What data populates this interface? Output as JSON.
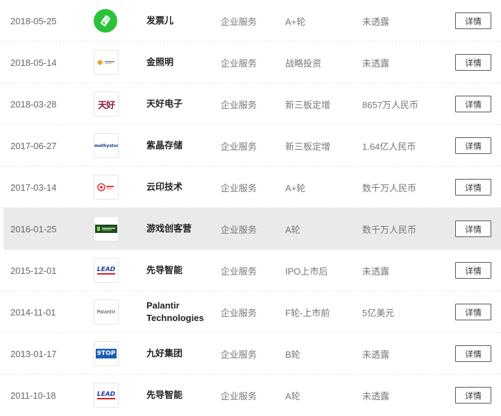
{
  "rows": [
    {
      "date": "2018-05-25",
      "name": "发票儿",
      "industry": "企业服务",
      "round": "A+轮",
      "amount": "未透露",
      "logo": "fapiaoer-logo",
      "action": "详情"
    },
    {
      "date": "2018-05-14",
      "name": "金照明",
      "industry": "企业服务",
      "round": "战略投资",
      "amount": "未透露",
      "logo": "jinzhaoming-logo",
      "action": "详情"
    },
    {
      "date": "2018-03-28",
      "name": "天好电子",
      "industry": "企业服务",
      "round": "新三板定增",
      "amount": "8657万人民币",
      "logo": "tianhao-logo",
      "logo_text": "天好",
      "action": "详情"
    },
    {
      "date": "2017-06-27",
      "name": "紫晶存储",
      "industry": "企业服务",
      "round": "新三板定增",
      "amount": "1.64亿人民币",
      "logo": "amethystum-logo",
      "logo_text": "amethystum",
      "action": "详情"
    },
    {
      "date": "2017-03-14",
      "name": "云印技术",
      "industry": "企业服务",
      "round": "A+轮",
      "amount": "数千万人民币",
      "logo": "yunyin-logo",
      "action": "详情"
    },
    {
      "date": "2016-01-25",
      "name": "游戏创客营",
      "industry": "企业服务",
      "round": "A轮",
      "amount": "数千万人民币",
      "logo": "youxichuangkeying-logo",
      "action": "详情"
    },
    {
      "date": "2015-12-01",
      "name": "先导智能",
      "industry": "企业服务",
      "round": "IPO上市后",
      "amount": "未透露",
      "logo": "lead-logo",
      "logo_text": "LEAD",
      "action": "详情"
    },
    {
      "date": "2014-11-01",
      "name": "Palantir Technologies",
      "industry": "企业服务",
      "round": "F轮-上市前",
      "amount": "5亿美元",
      "logo": "palantir-logo",
      "logo_text": "Palantir",
      "action": "详情"
    },
    {
      "date": "2013-01-17",
      "name": "九好集团",
      "industry": "企业服务",
      "round": "B轮",
      "amount": "未透露",
      "logo": "9top-logo",
      "logo_text": "9TOP",
      "action": "详情"
    },
    {
      "date": "2011-10-18",
      "name": "先导智能",
      "industry": "企业服务",
      "round": "A轮",
      "amount": "未透露",
      "logo": "lead-logo",
      "logo_text": "LEAD",
      "action": "详情"
    }
  ]
}
